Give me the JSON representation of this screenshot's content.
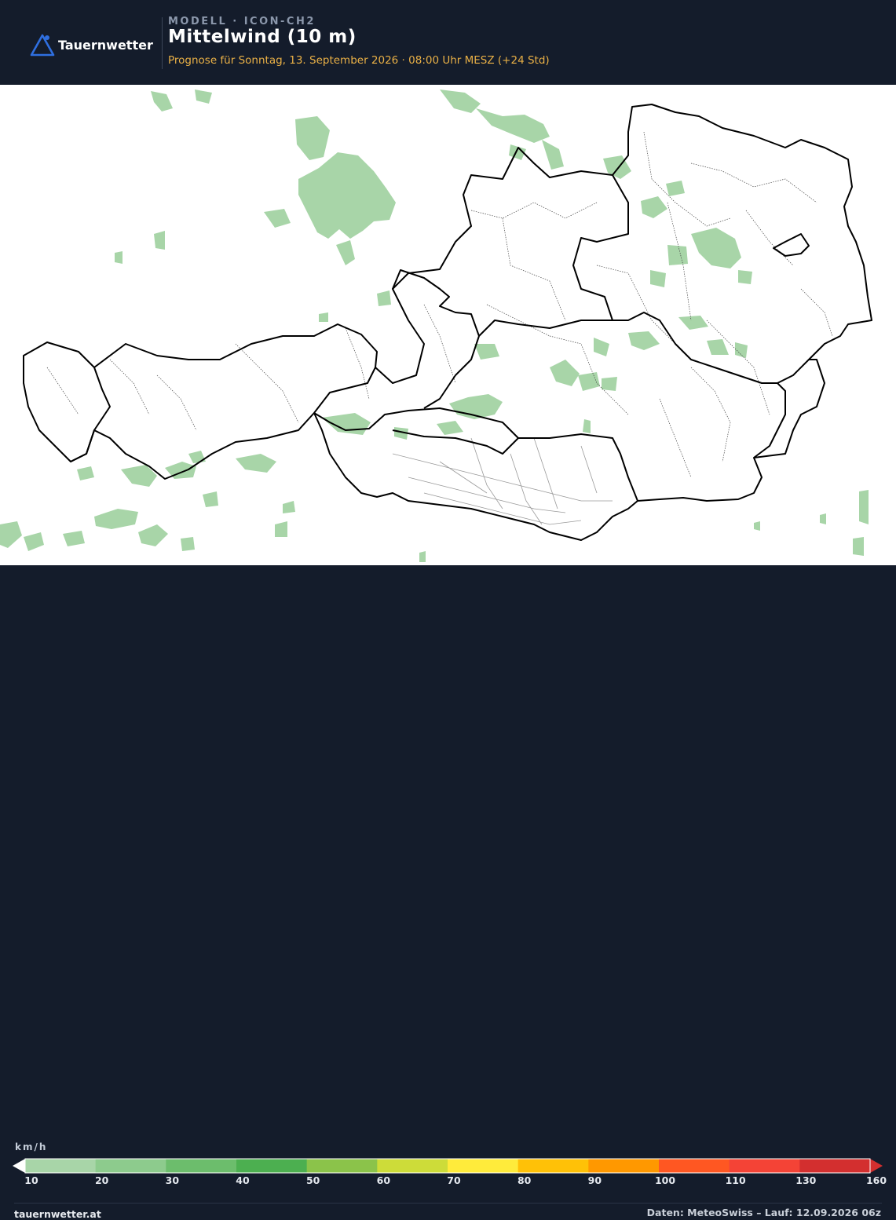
{
  "brand": {
    "name": "Tauernwetter",
    "icon": "mountain-triangle-icon",
    "color": "#2f6fe0"
  },
  "header": {
    "model": "MODELL · ICON-CH2",
    "title": "Mittelwind (10 m)",
    "subtitle": "Prognose für Sonntag, 13. September 2026 · 08:00 Uhr MESZ  (+24 Std)"
  },
  "legend": {
    "unit": "km/h",
    "bins": [
      {
        "from": 10,
        "to": 20,
        "color": "#a8d5a8"
      },
      {
        "from": 20,
        "to": 30,
        "color": "#8dcb8d"
      },
      {
        "from": 30,
        "to": 40,
        "color": "#6cbd6c"
      },
      {
        "from": 40,
        "to": 50,
        "color": "#4caf50"
      },
      {
        "from": 50,
        "to": 60,
        "color": "#8bc34a"
      },
      {
        "from": 60,
        "to": 70,
        "color": "#cddc39"
      },
      {
        "from": 70,
        "to": 80,
        "color": "#ffeb3b"
      },
      {
        "from": 80,
        "to": 90,
        "color": "#ffc107"
      },
      {
        "from": 90,
        "to": 100,
        "color": "#ff9800"
      },
      {
        "from": 100,
        "to": 110,
        "color": "#ff5722"
      },
      {
        "from": 110,
        "to": 130,
        "color": "#f44336"
      },
      {
        "from": 130,
        "to": 160,
        "color": "#d32f2f"
      }
    ],
    "ticks": [
      "10",
      "20",
      "30",
      "40",
      "50",
      "60",
      "70",
      "80",
      "90",
      "100",
      "110",
      "130",
      "160"
    ]
  },
  "footer": {
    "site": "tauernwetter.at",
    "source": "Daten: MeteoSwiss – Lauf: 12.09.2026 06z"
  },
  "map": {
    "region": "Österreich",
    "max_class_shown": "10–20 km/h",
    "fill_color": "#a8d5a8"
  }
}
